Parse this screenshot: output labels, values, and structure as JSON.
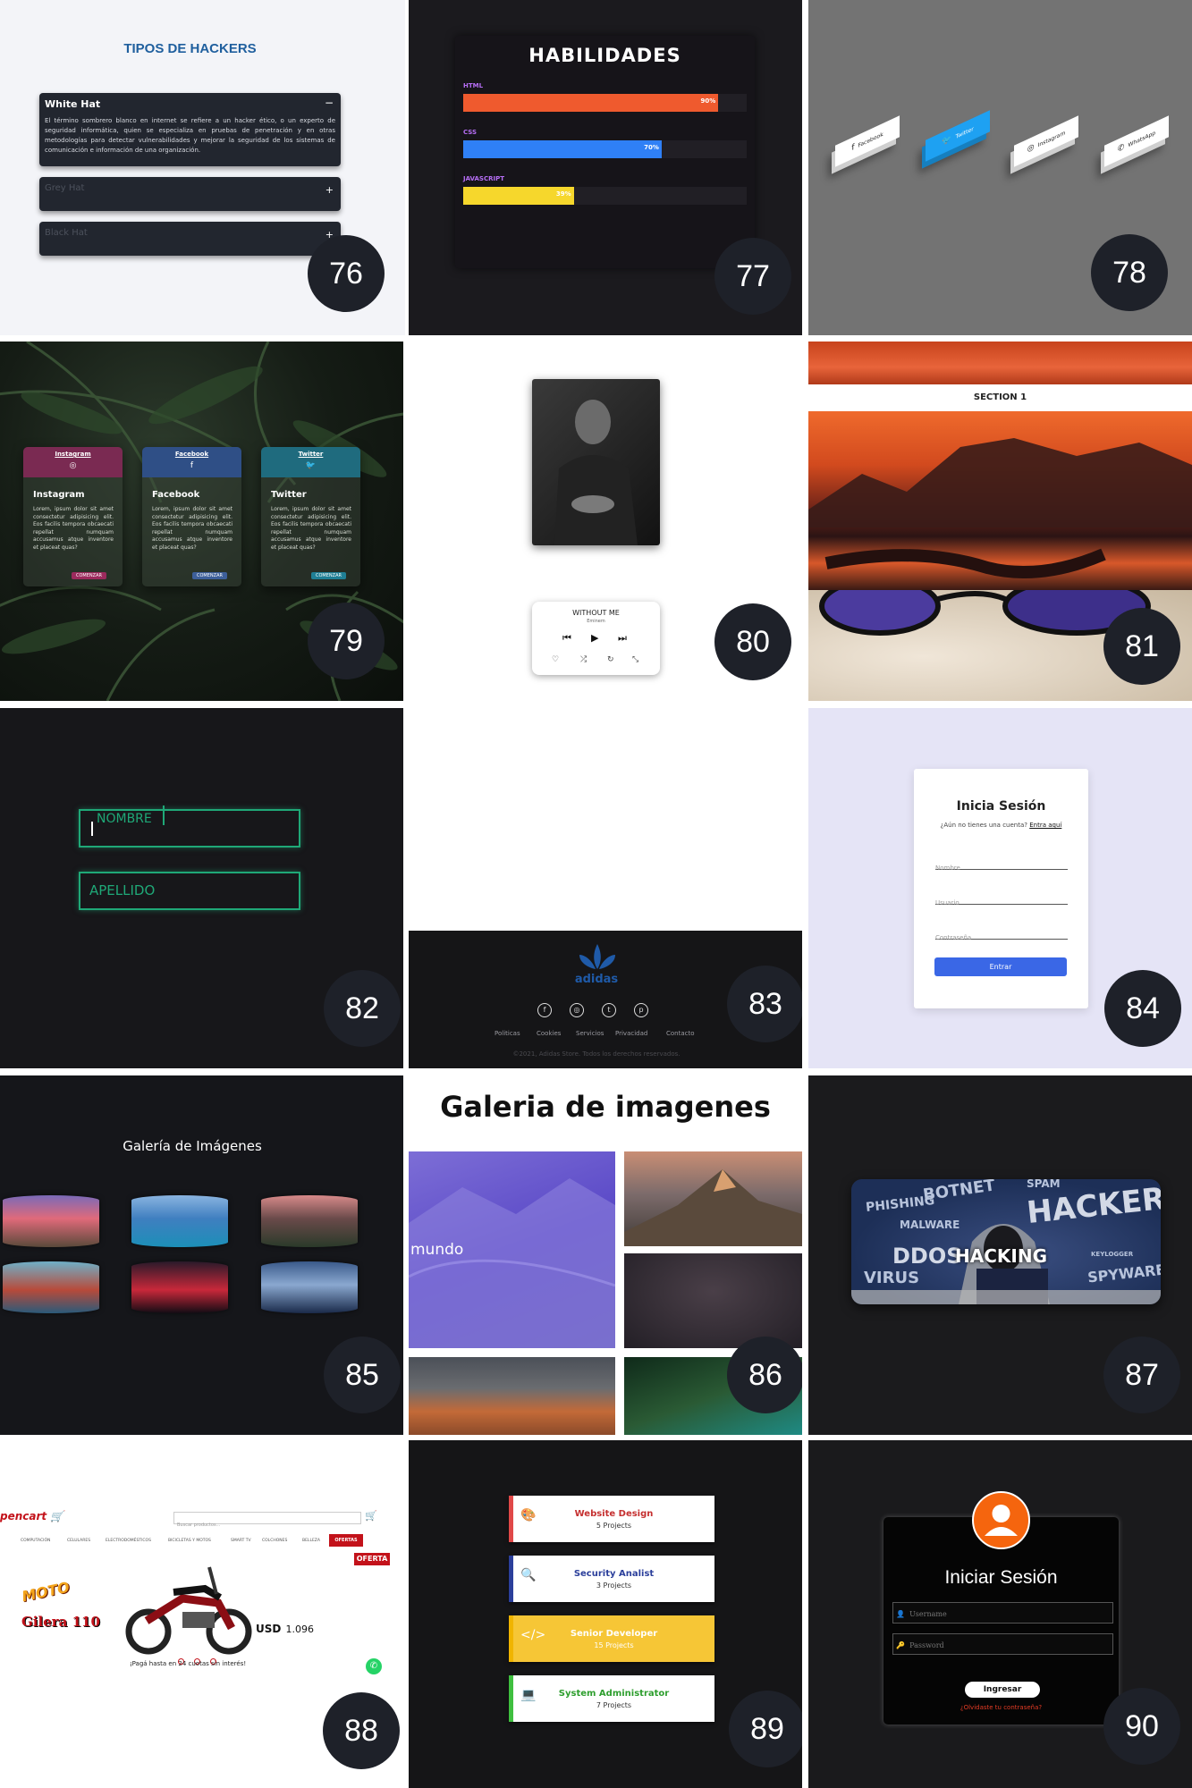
{
  "t76": {
    "title": "TIPOS DE HACKERS",
    "items": [
      {
        "title": "White Hat",
        "icon": "−",
        "text": "El término sombrero blanco en internet se refiere a un hacker ético, o un experto de seguridad informática, quien se especializa en pruebas de penetración y en otras metodologías para detectar vulnerabilidades y mejorar la seguridad de los sistemas de comunicación e información de una organización."
      },
      {
        "title": "Grey Hat",
        "icon": "+"
      },
      {
        "title": "Black Hat",
        "icon": "+"
      }
    ],
    "number": "76"
  },
  "t77": {
    "title": "HABILIDADES",
    "skills": [
      {
        "name": "HTML",
        "value": 90,
        "label": "90%",
        "color": "#ef5a2e"
      },
      {
        "name": "CSS",
        "value": 70,
        "label": "70%",
        "color": "#2f80f6"
      },
      {
        "name": "JAVASCRIPT",
        "value": 39,
        "label": "39%",
        "color": "#f6d72c"
      }
    ],
    "number": "77"
  },
  "t78": {
    "buttons": [
      {
        "label": "Facebook",
        "icon": "facebook-icon",
        "glyph": "f"
      },
      {
        "label": "Twitter",
        "icon": "twitter-icon",
        "glyph": "🐦"
      },
      {
        "label": "Instagram",
        "icon": "instagram-icon",
        "glyph": "◎"
      },
      {
        "label": "WhatsApp",
        "icon": "whatsapp-icon",
        "glyph": "✆"
      }
    ],
    "number": "78"
  },
  "t79": {
    "cards": [
      {
        "tab": "Instagram",
        "glyph": "◎",
        "title": "Instagram",
        "text": "Lorem, ipsum dolor sit amet consectetur adipisicing elit. Eos facilis tempora obcaecati repellat numquam accusamus atque inventore et placeat quas?",
        "button": "COMENZAR",
        "color": "#7a2a52",
        "btnColor": "#9c2a5d"
      },
      {
        "tab": "Facebook",
        "glyph": "f",
        "title": "Facebook",
        "text": "Lorem, ipsum dolor sit amet consectetur adipisicing elit. Eos facilis tempora obcaecati repellat numquam accusamus atque inventore et placeat quas?",
        "button": "COMENZAR",
        "color": "#2f4f86",
        "btnColor": "#3d5f9a"
      },
      {
        "tab": "Twitter",
        "glyph": "🐦",
        "title": "Twitter",
        "text": "Lorem, ipsum dolor sit amet consectetur adipisicing elit. Eos facilis tempora obcaecati repellat numquam accusamus atque inventore et placeat quas?",
        "button": "COMENZAR",
        "color": "#1f6b7e",
        "btnColor": "#1f7f95"
      }
    ],
    "number": "79"
  },
  "t80": {
    "song": "WITHOUT ME",
    "artist": "Eminem",
    "controls": [
      "⏮",
      "▶",
      "⏭"
    ],
    "icons": [
      "♡",
      "⤮",
      "↻",
      "⤡"
    ],
    "number": "80"
  },
  "t81": {
    "section": "SECTION 1",
    "number": "81"
  },
  "t82": {
    "field1": "NOMBRE",
    "field2": "APELLIDO",
    "number": "82"
  },
  "t83": {
    "brand": "adidas",
    "links": [
      "Politicas",
      "Cookies",
      "Servicios",
      "Privacidad",
      "Contacto"
    ],
    "copyright": "©2021, Adidas Store. Todos los derechos reservados.",
    "number": "83"
  },
  "t84": {
    "title": "Inicia Sesión",
    "subtitle": "¿Aún no tienes una cuenta?",
    "link": "Entra aquí",
    "fields": [
      "Nombre",
      "Usuario",
      "Contraseña"
    ],
    "button": "Entrar",
    "number": "84"
  },
  "t85": {
    "title": "Galería de Imágenes",
    "number": "85"
  },
  "t86": {
    "title": "Galeria de imagenes",
    "caption": "mundo",
    "number": "86"
  },
  "t87": {
    "words": [
      "BOTNET",
      "SPAM",
      "PHISHING",
      "MALWARE",
      "HACKER",
      "DDOS",
      "HACKING",
      "KEYLOGGER",
      "VIRUS",
      "SPYWARE"
    ],
    "number": "87"
  },
  "t88": {
    "logo": "pencart",
    "search": "Buscar productos...",
    "menu": [
      "COMPUTACIÓN",
      "CELULARES",
      "ELECTRODOMÉSTICOS",
      "BICICLETAS Y MOTOS",
      "SMART TV",
      "COLCHONES",
      "BELLEZA"
    ],
    "ofertas": "OFERTAS",
    "oferta": "OFERTA",
    "moto": "MOTO",
    "model": "Gilera 110",
    "currency": "USD",
    "price": "1.096",
    "payment": "¡Pagá hasta en 24 cuotas sin interés!",
    "number": "88"
  },
  "t89": {
    "items": [
      {
        "title": "Website Design",
        "sub": "5 Projects",
        "color": "#e04848",
        "bg": "#ffffff",
        "titleColor": "#c53030",
        "icon": "palette-icon",
        "glyph": "🎨"
      },
      {
        "title": "Security Analist",
        "sub": "3 Projects",
        "color": "#2b3f9b",
        "bg": "#ffffff",
        "titleColor": "#2b3f9b",
        "icon": "search-icon",
        "glyph": "🔍"
      },
      {
        "title": "Senior Developer",
        "sub": "15 Projects",
        "color": "#f0b400",
        "bg": "#f6c636",
        "titleColor": "#ffffff",
        "icon": "code-icon",
        "glyph": "</>"
      },
      {
        "title": "System Administrator",
        "sub": "7 Projects",
        "color": "#3fbf3f",
        "bg": "#ffffff",
        "titleColor": "#2e9e2e",
        "icon": "laptop-icon",
        "glyph": "💻"
      }
    ],
    "number": "89"
  },
  "t90": {
    "title": "Iniciar Sesión",
    "username": "Username",
    "password": "Password",
    "button": "Ingresar",
    "forgot": "¿Olvidaste tu contraseña?",
    "number": "90"
  }
}
